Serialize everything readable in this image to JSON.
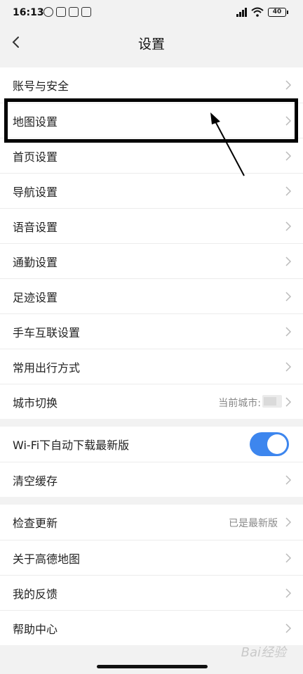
{
  "status_bar": {
    "time": "16:13",
    "battery": "40"
  },
  "header": {
    "title": "设置"
  },
  "group1": [
    {
      "label": "账号与安全"
    },
    {
      "label": "地图设置"
    },
    {
      "label": "首页设置"
    },
    {
      "label": "导航设置"
    },
    {
      "label": "语音设置"
    },
    {
      "label": "通勤设置"
    },
    {
      "label": "足迹设置"
    },
    {
      "label": "手车互联设置"
    },
    {
      "label": "常用出行方式"
    },
    {
      "label": "城市切换",
      "value": "当前城市:"
    }
  ],
  "group2": {
    "wifi_download_label": "Wi-Fi下自动下载最新版",
    "wifi_download_enabled": true,
    "clear_cache_label": "清空缓存"
  },
  "group3": [
    {
      "label": "检查更新",
      "value": "已是最新版"
    },
    {
      "label": "关于高德地图"
    },
    {
      "label": "我的反馈"
    },
    {
      "label": "帮助中心"
    }
  ],
  "watermark": "Bai经验",
  "colors": {
    "accent": "#3d86ee",
    "background": "#f2f2f2"
  }
}
